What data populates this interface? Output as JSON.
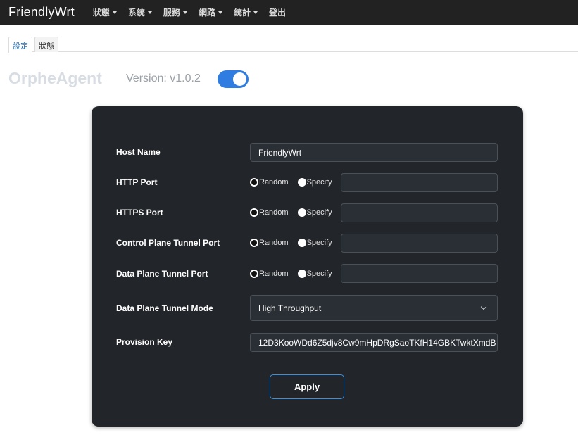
{
  "navbar": {
    "brand": "FriendlyWrt",
    "menu": [
      {
        "label": "狀態",
        "has_caret": true
      },
      {
        "label": "系統",
        "has_caret": true
      },
      {
        "label": "服務",
        "has_caret": true
      },
      {
        "label": "網路",
        "has_caret": true
      },
      {
        "label": "統計",
        "has_caret": true
      },
      {
        "label": "登出",
        "has_caret": false
      }
    ]
  },
  "tabs": [
    {
      "label": "設定",
      "active": true
    },
    {
      "label": "狀態",
      "active": false
    }
  ],
  "header": {
    "title": "OrpheAgent",
    "version": "Version: v1.0.2",
    "enabled": true
  },
  "form": {
    "host_name": {
      "label": "Host Name",
      "value": "FriendlyWrt"
    },
    "ports": [
      {
        "label": "HTTP Port",
        "selected": "Random",
        "value": ""
      },
      {
        "label": "HTTPS Port",
        "selected": "Random",
        "value": ""
      },
      {
        "label": "Control Plane Tunnel Port",
        "selected": "Random",
        "value": ""
      },
      {
        "label": "Data Plane Tunnel Port",
        "selected": "Random",
        "value": ""
      }
    ],
    "radio_options": {
      "random": "Random",
      "specify": "Specify"
    },
    "tunnel_mode": {
      "label": "Data Plane Tunnel Mode",
      "value": "High Throughput"
    },
    "provision_key": {
      "label": "Provision Key",
      "value": "12D3KooWDd6Z5djv8Cw9mHpDRgSaoTKfH14GBKTwktXmdB"
    },
    "apply_label": "Apply"
  },
  "colors": {
    "navbar_bg": "#222222",
    "panel_bg": "#222529",
    "toggle_on": "#2f7de1",
    "apply_border": "#3c8fd9"
  }
}
